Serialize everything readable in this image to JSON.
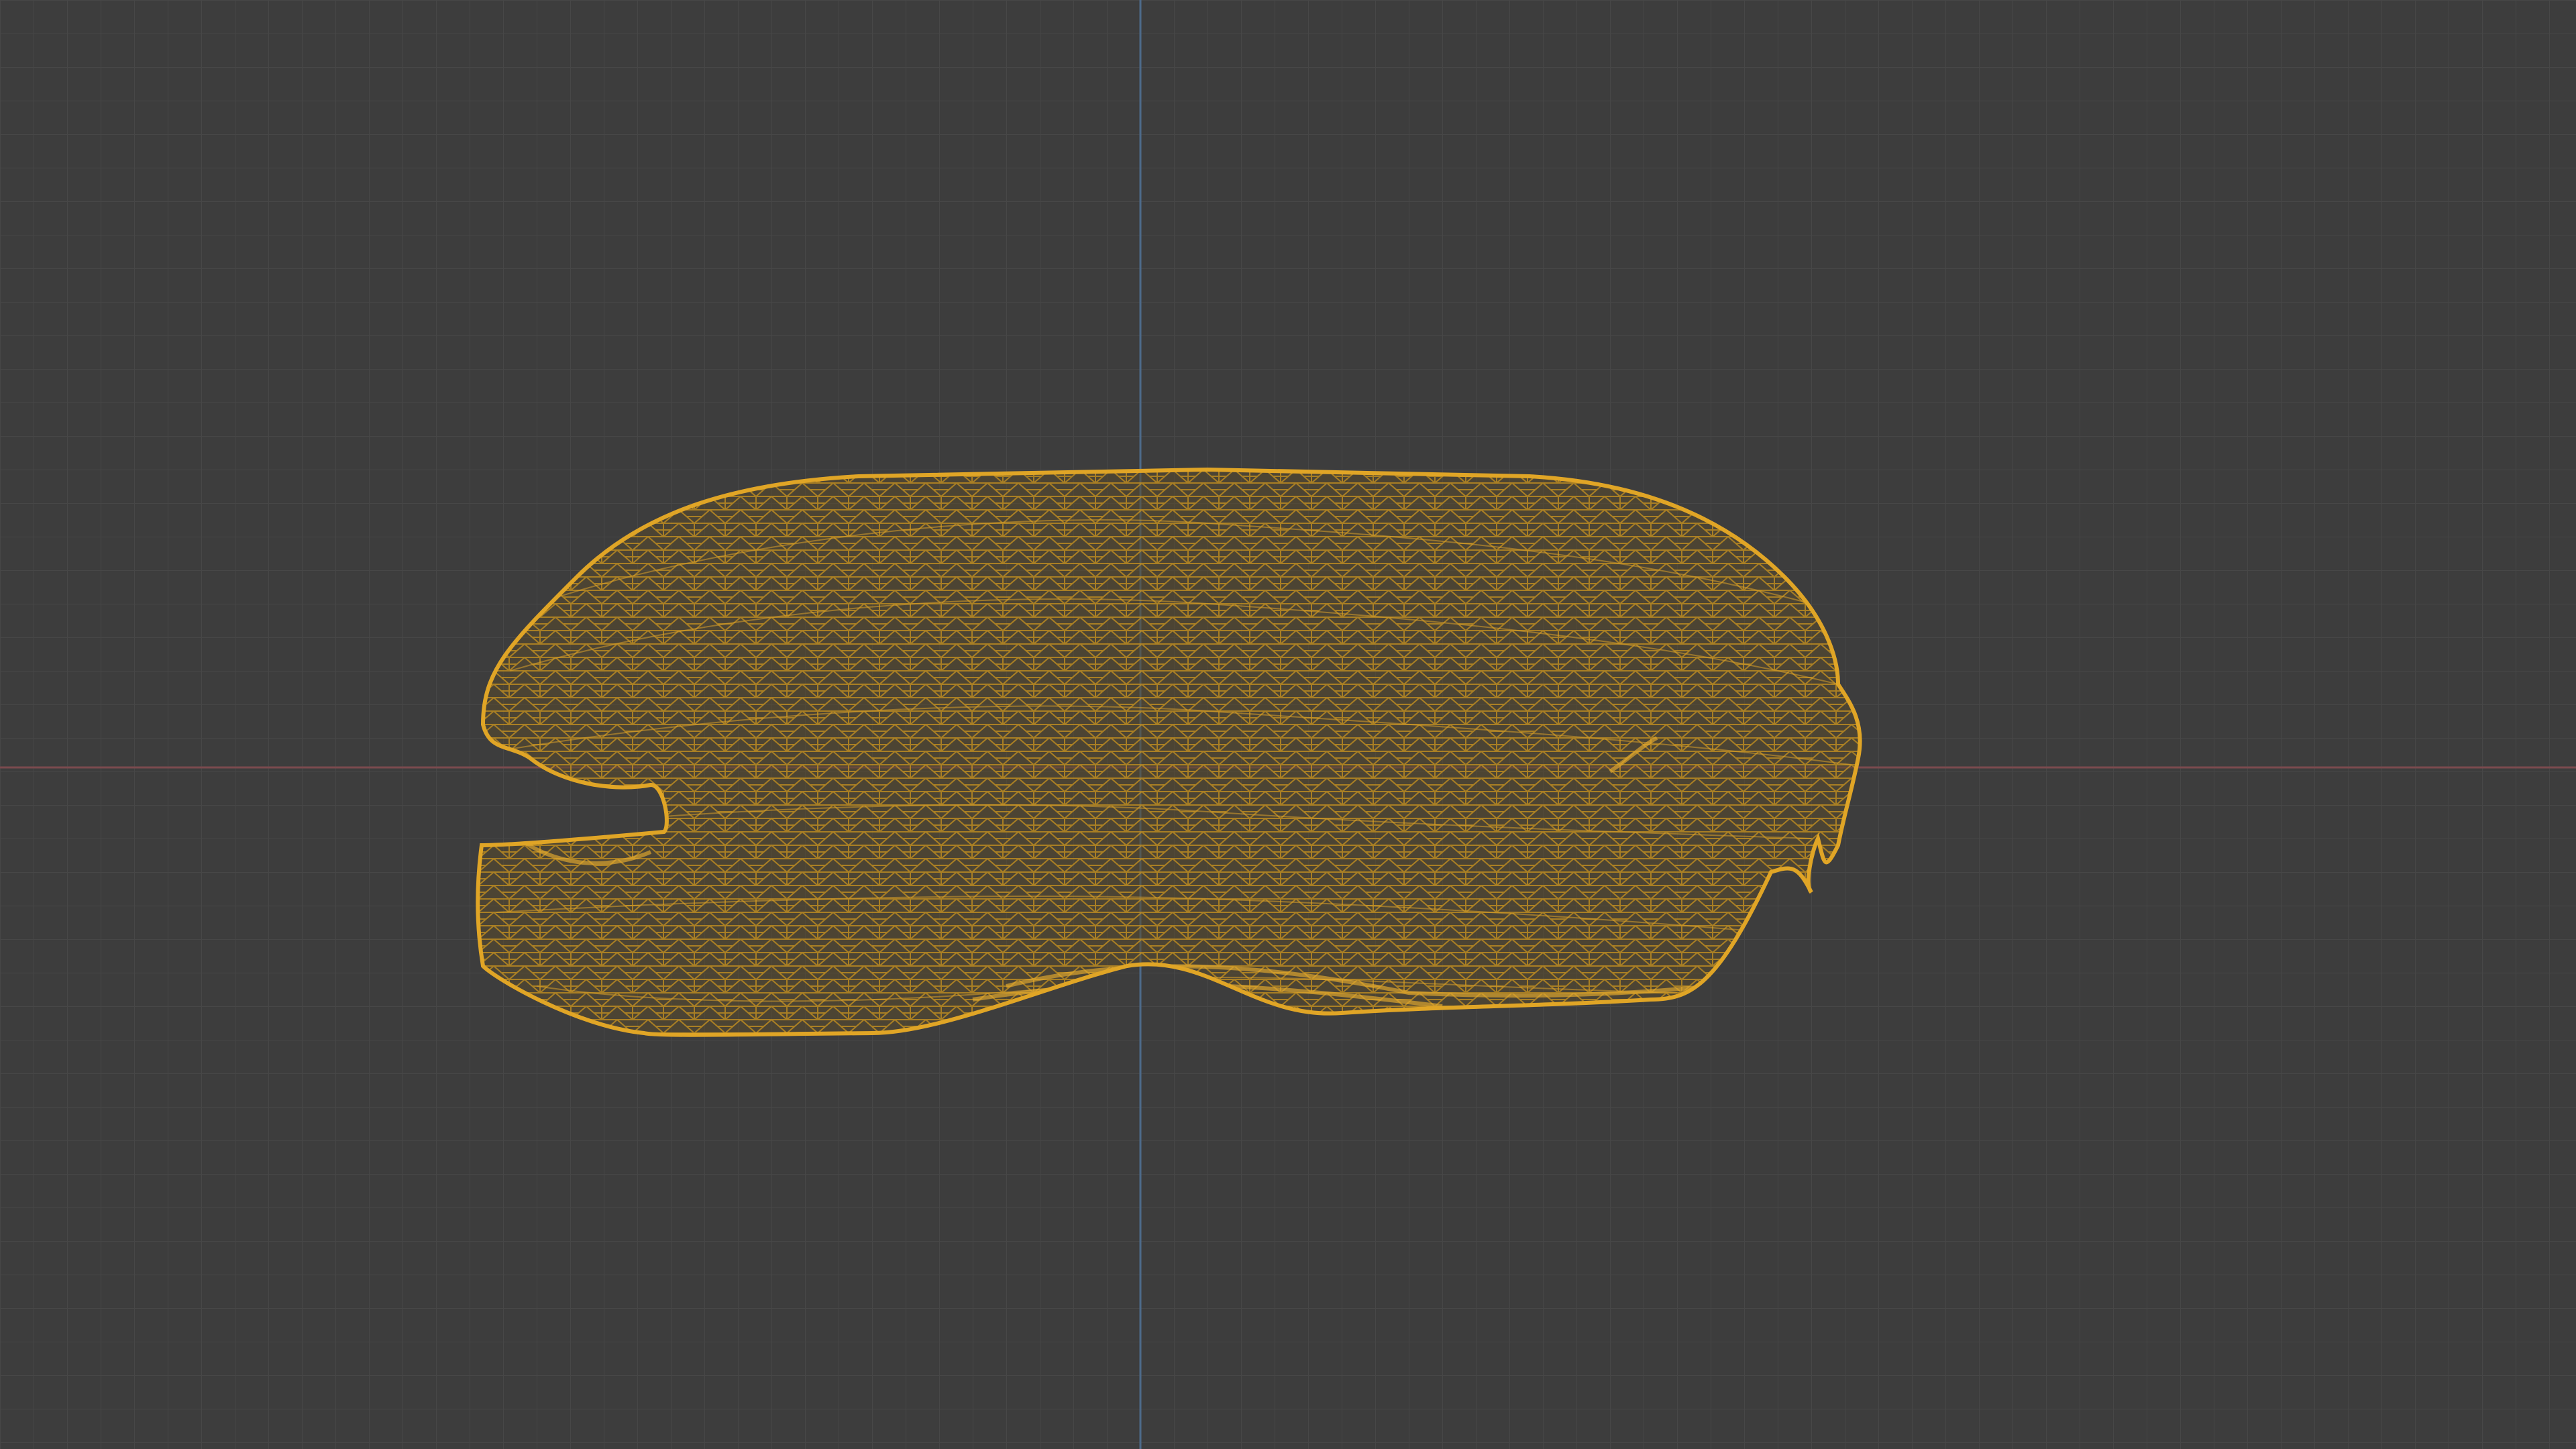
{
  "viewport": {
    "view": "front-orthographic",
    "shading": "wireframe",
    "background_color": "#3d3d3d",
    "grid": true,
    "grid_color": "#474747",
    "x_axis_color": "#7a4a4e",
    "z_axis_color": "#4d6a8a",
    "selected_object": {
      "name_visible": false,
      "wire_color": "#e0a526",
      "shape": "bread-loaf",
      "selected": true
    }
  }
}
